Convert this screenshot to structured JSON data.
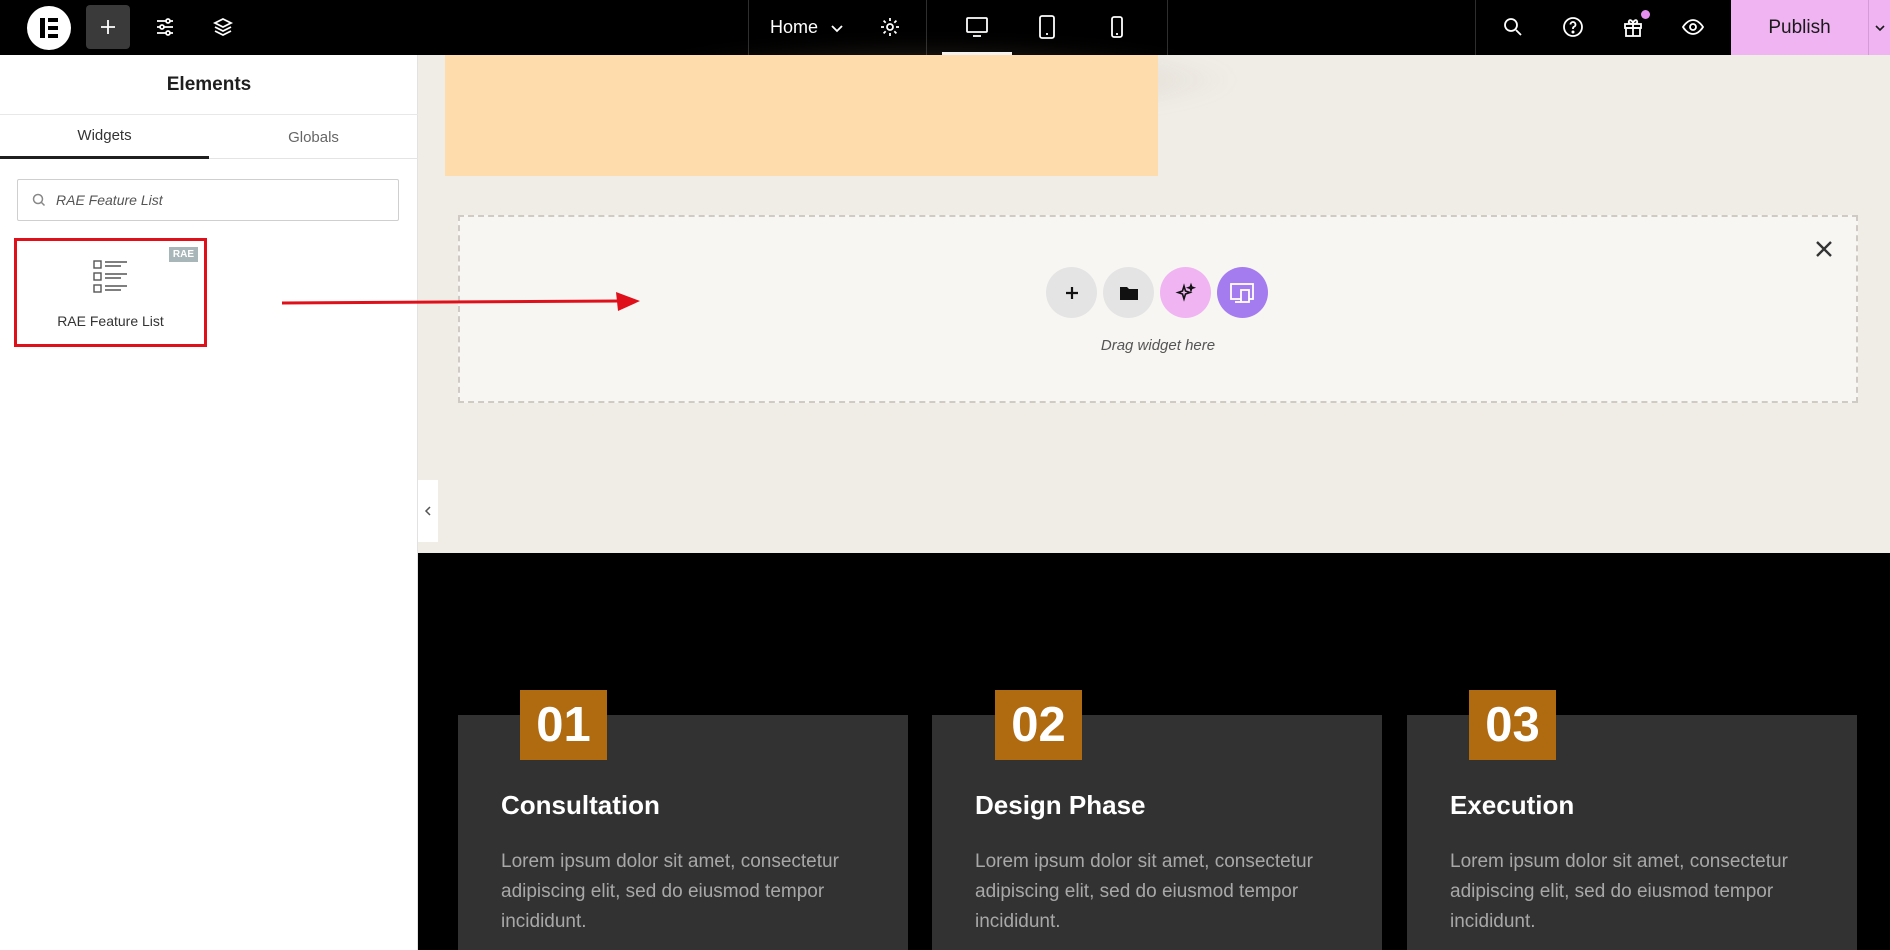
{
  "topbar": {
    "page_name": "Home",
    "publish_label": "Publish",
    "icons": [
      "elementor-logo-icon",
      "plus-icon",
      "sliders-icon",
      "layers-icon",
      "chevron-down-icon",
      "gear-icon",
      "desktop-icon",
      "tablet-icon",
      "mobile-icon",
      "search-icon",
      "help-icon",
      "gift-icon",
      "eye-icon"
    ]
  },
  "panel": {
    "title": "Elements",
    "tabs": [
      {
        "label": "Widgets"
      },
      {
        "label": "Globals"
      }
    ],
    "search_value": "RAE Feature List",
    "widget": {
      "label": "RAE Feature List",
      "badge": "RAE"
    }
  },
  "dropzone": {
    "hint": "Drag widget here"
  },
  "features": [
    {
      "number": "01",
      "title": "Consultation",
      "text": "Lorem ipsum dolor sit amet, consectetur adipiscing elit, sed do eiusmod tempor incididunt."
    },
    {
      "number": "02",
      "title": "Design Phase",
      "text": "Lorem ipsum dolor sit amet, consectetur adipiscing elit, sed do eiusmod tempor incididunt."
    },
    {
      "number": "03",
      "title": "Execution",
      "text": "Lorem ipsum dolor sit amet, consectetur adipiscing elit, sed do eiusmod tempor incididunt."
    }
  ],
  "colors": {
    "accent": "#f0b4f2",
    "number_bg": "#b06a10",
    "highlight": "#e0101a"
  }
}
